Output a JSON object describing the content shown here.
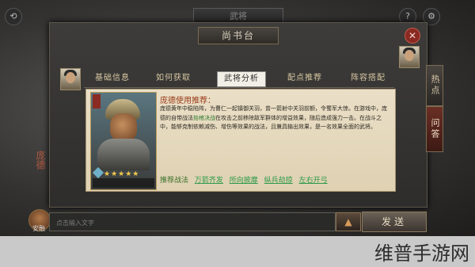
{
  "top": {
    "label": "武将"
  },
  "panel": {
    "title": "尚书台",
    "close_icon": "close-icon"
  },
  "left_strip": {
    "general_name": "庞德",
    "avatar_label": "安融"
  },
  "tabs": [
    {
      "label": "基础信息",
      "active": false
    },
    {
      "label": "如何获取",
      "active": false
    },
    {
      "label": "武将分析",
      "active": true
    },
    {
      "label": "配点推荐",
      "active": false
    },
    {
      "label": "阵容搭配",
      "active": false
    }
  ],
  "side_buttons": [
    {
      "label": "热点",
      "active": false
    },
    {
      "label": "问答",
      "active": true
    }
  ],
  "card": {
    "stars": "★★★★★",
    "name": "庞德"
  },
  "content": {
    "title": "庞德使用推荐：",
    "body_pre": "庞德黄年中稳陷阵，为曹仁一起镇御关羽，曾一箭射中关羽前额，令蜀军大惊。在游戏中，庞德的自带战法",
    "body_highlight": "抬棺决战",
    "body_post": "在攻击之前移除敌军群体的增益效果，随后造成强力一击。在战斗之中，能够克制依赖减伤、增伤等效果的战法，且兼具输出效果，是一名效果全面的武将。",
    "recommend_label": "推荐战法",
    "recommend_items": [
      "万箭齐发",
      "所向披靡",
      "纵兵劫掠",
      "左右开弓"
    ]
  },
  "input": {
    "placeholder": "点击输入文字"
  },
  "buttons": {
    "up_icon": "upload-arrow-icon",
    "send_label": "发送"
  },
  "watermark": "维普手游网"
}
